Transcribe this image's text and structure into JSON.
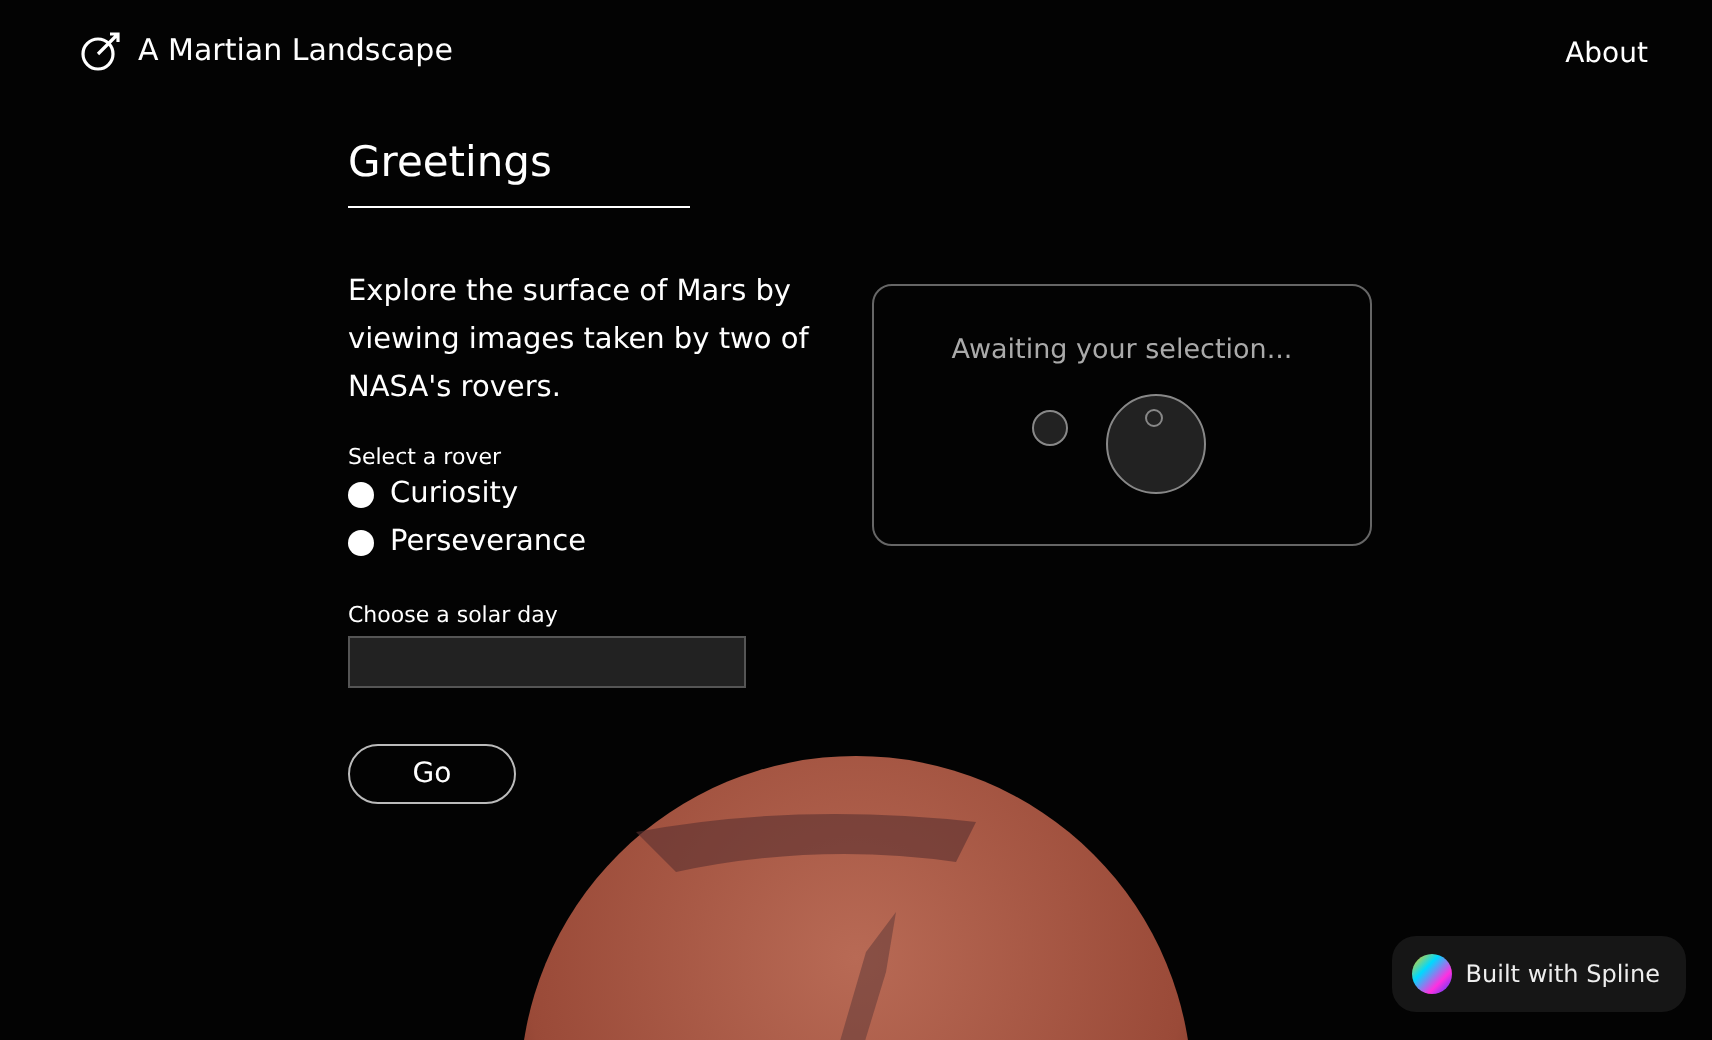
{
  "header": {
    "title": "A Martian Landscape",
    "nav": [
      "About"
    ]
  },
  "form": {
    "heading": "Greetings",
    "intro": "Explore the surface of Mars by viewing images taken by two of NASA's rovers.",
    "rover_label": "Select a rover",
    "rovers": [
      {
        "label": "Curiosity",
        "selected": false
      },
      {
        "label": "Perseverance",
        "selected": false
      }
    ],
    "sol_label": "Choose a solar day",
    "submit": "Go"
  },
  "status_card": {
    "message": "Awaiting your selection..."
  },
  "badge": {
    "label": "Built with Spline"
  }
}
